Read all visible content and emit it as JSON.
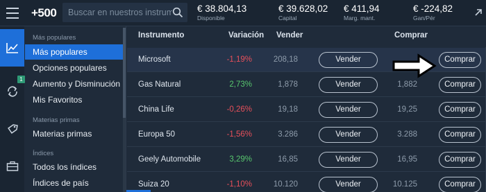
{
  "header": {
    "logo": "+500",
    "search_placeholder": "Buscar en nuestros instrumentos",
    "metrics": [
      {
        "value": "€ 38.804,13",
        "label": "Disponible"
      },
      {
        "value": "€ 39.628,02",
        "label": "Capital"
      },
      {
        "value": "€ 411,94",
        "label": "Marg. mant."
      },
      {
        "value": "€ -224,82",
        "label": "Gan/Pér"
      }
    ]
  },
  "rail": {
    "notification_count": "1"
  },
  "sidebar": {
    "sections": [
      {
        "title": "Más populares",
        "items": [
          "Más populares",
          "Opciones populares",
          "Aumento y Disminución",
          "Mis Favoritos"
        ]
      },
      {
        "title": "Materias primas",
        "items": [
          "Materias primas"
        ]
      },
      {
        "title": "Índices",
        "items": [
          "Todos los índices",
          "Índices de país"
        ]
      }
    ],
    "active_item": "Más populares"
  },
  "table": {
    "columns": {
      "instrument": "Instrumento",
      "change": "Variación",
      "sell": "Vender",
      "buy": "Comprar"
    },
    "sell_label": "Vender",
    "buy_label": "Comprar",
    "rows": [
      {
        "name": "Microsoft",
        "change": "-1,19%",
        "dir": "neg",
        "sell": "208,18",
        "buy": ""
      },
      {
        "name": "Gas Natural",
        "change": "2,73%",
        "dir": "pos",
        "sell": "1,878",
        "buy": "1,882"
      },
      {
        "name": "China Life",
        "change": "-0,26%",
        "dir": "neg",
        "sell": "19,18",
        "buy": "19,25"
      },
      {
        "name": "Europa 50",
        "change": "-1,56%",
        "dir": "neg",
        "sell": "3.286",
        "buy": "3.288"
      },
      {
        "name": "Geely Automobile",
        "change": "3,29%",
        "dir": "pos",
        "sell": "16,85",
        "buy": "16,95"
      },
      {
        "name": "Suiza 20",
        "change": "-1,10%",
        "dir": "neg",
        "sell": "10.120",
        "buy": "10.125"
      }
    ]
  },
  "colors": {
    "accent": "#1e6fd9",
    "negative": "#e8505b",
    "positive": "#58c76e",
    "background": "#1f2b3a"
  }
}
